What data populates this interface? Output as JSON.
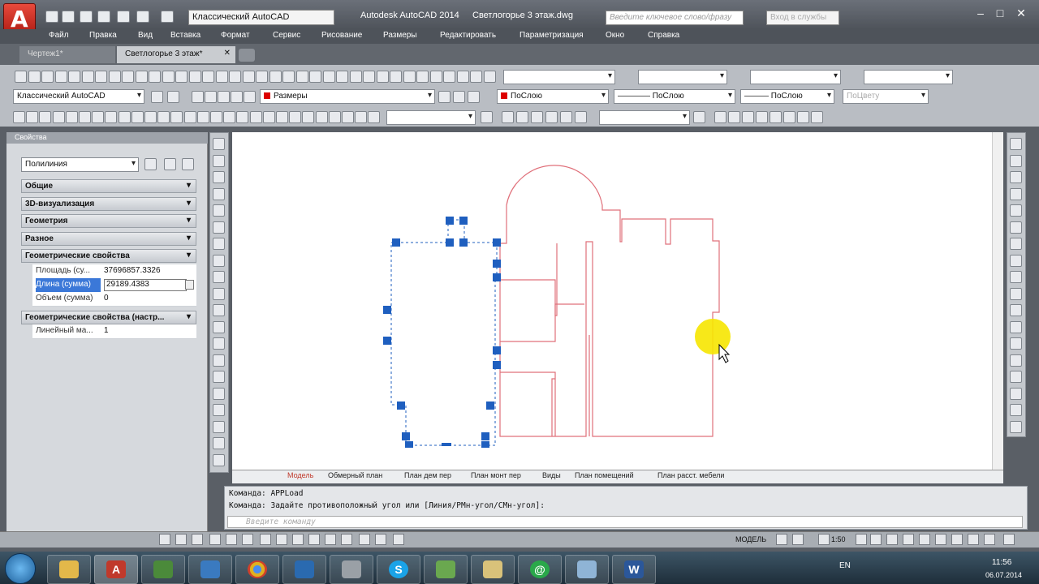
{
  "app": {
    "title": "Autodesk AutoCAD 2014",
    "document": "Светлогорье 3 этаж.dwg",
    "workspace": "Классический AutoCAD",
    "search_placeholder": "Введите ключевое слово/фразу",
    "signin": "Вход в службы"
  },
  "menu": [
    "Файл",
    "Правка",
    "Вид",
    "Вставка",
    "Формат",
    "Сервис",
    "Рисование",
    "Размеры",
    "Редактировать",
    "Параметризация",
    "Окно",
    "Справка"
  ],
  "doc_tabs": [
    "Чертеж1*",
    "Светлогорье 3 этаж*"
  ],
  "toolbars": {
    "workspace_combo": "Классический AutoCAD",
    "layer_combo": "Размеры",
    "color_combo": "ПоСлою",
    "linetype_combo": "ПоСлою",
    "lineweight_combo": "ПоСлою",
    "plotstyle_combo": "ПоЦвету"
  },
  "properties": {
    "title": "Свойства",
    "object_type": "Полилиния",
    "sections": [
      "Общие",
      "3D-визуализация",
      "Геометрия",
      "Разное",
      "Геометрические свойства"
    ],
    "rows": [
      {
        "key": "Площадь (су...",
        "value": "37696857.3326"
      },
      {
        "key": "Длина (сумма)",
        "value": "29189.4383"
      },
      {
        "key": "Объем (сумма)",
        "value": "0"
      }
    ],
    "section2": "Геометрические свойства (настр...",
    "rows2": [
      {
        "key": "Линейный ма...",
        "value": "1"
      }
    ]
  },
  "layout_tabs": [
    "Модель",
    "Обмерный план",
    "План дем пер",
    "План монт пер",
    "Виды",
    "План помещений",
    "План расст. мебели"
  ],
  "command": {
    "line1": "Команда: APPLoad",
    "line2": "Команда: Задайте противоположный угол или [Линия/РМн-угол/СМн-угол]:",
    "placeholder": "Введите команду"
  },
  "status": {
    "model": "МОДЕЛЬ",
    "scale": "1:50"
  },
  "taskbar": {
    "lang": "EN",
    "time": "11:56",
    "date": "06.07.2014"
  },
  "colors": {
    "accent": "#c0392b",
    "selection": "#1f5fbf",
    "geometry": "#e0707a"
  }
}
